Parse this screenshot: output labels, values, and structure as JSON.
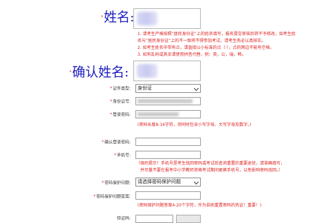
{
  "required_mark": "*",
  "name_label": "姓名:",
  "notes_top": [
    "1. 请考生严格按照“居民身份证”上的姓名填写，报名提交审核后将不予修改，如考生姓",
    "名与“居民身份证”上的不一致将不得参加考试，请考生务必认真核实。",
    "2. 如考生姓名中带有点，请直接以小标准的点（·），点的两边不能有空格。",
    "3. 如有乱码或其余请使用拼音代替，例：英，公，瑞，韩。"
  ],
  "confirm_name_label": "确认姓名:",
  "id_type": {
    "label": "证件类型:",
    "value": "身份证"
  },
  "id_number": {
    "label": "身份证号:"
  },
  "password": {
    "label": "登录密码:"
  },
  "password_note": "(密码长度8-16字符，须同时包含小写字母、大写字母及数字。)",
  "confirm_password": {
    "label": "确认登录密码:"
  },
  "phone": {
    "label": "手机号:"
  },
  "phone_note": [
    "（强烈提示！手机号是考生找回密码或考试后查询重置的重要途径，请准确填写，",
    "并尽量不要在报考中小学教师资格考试期间更换手机号，以免影响密码找回。）"
  ],
  "security_question": {
    "label": "密码保护问题:",
    "value": "请选择密码保护问题"
  },
  "security_answer": {
    "label": "密码保护问题答案:"
  },
  "answer_note": "(密码保护问题答案4-20个字符，作为自助重置密码的凭证！重要！)",
  "captcha_label": "验证码:"
}
